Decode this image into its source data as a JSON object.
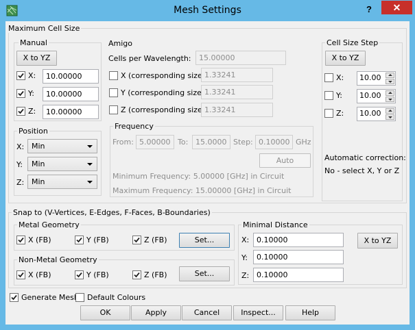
{
  "window": {
    "title": "Mesh Settings",
    "help_glyph": "?",
    "close_glyph": "✕"
  },
  "max_cell": {
    "title": "Maximum Cell Size",
    "manual": {
      "title": "Manual",
      "xtoyz_label": "X to YZ",
      "x": {
        "label": "X:",
        "value": "10.00000",
        "checked": true
      },
      "y": {
        "label": "Y:",
        "value": "10.00000",
        "checked": true
      },
      "z": {
        "label": "Z:",
        "value": "10.00000",
        "checked": true
      }
    },
    "position": {
      "title": "Position",
      "x": {
        "label": "X:",
        "value": "Min"
      },
      "y": {
        "label": "Y:",
        "value": "Min"
      },
      "z": {
        "label": "Z:",
        "value": "Min"
      }
    },
    "amigo": {
      "title": "Amigo",
      "cells_label": "Cells per Wavelength:",
      "cells_value": "15.00000",
      "x": {
        "label": "X (corresponding size)",
        "value": "1.33241"
      },
      "y": {
        "label": "Y (corresponding size)",
        "value": "1.33241"
      },
      "z": {
        "label": "Z (corresponding size)",
        "value": "1.33241"
      },
      "frequency": {
        "title": "Frequency",
        "from_label": "From:",
        "from_value": "5.00000",
        "to_label": "To:",
        "to_value": "15.00000",
        "step_label": "Step:",
        "step_value": "0.10000",
        "unit": "GHz",
        "auto_label": "Auto",
        "min_text": "Minimum Frequency: 5.00000 [GHz] in Circuit",
        "max_text": "Maximum Frequency: 15.00000 [GHz] in Circuit"
      }
    },
    "step": {
      "title": "Cell Size Step",
      "xtoyz_label": "X to YZ",
      "x": {
        "label": "X:",
        "value": "10.00"
      },
      "y": {
        "label": "Y:",
        "value": "10.00"
      },
      "z": {
        "label": "Z:",
        "value": "10.00"
      },
      "auto_title": "Automatic correction:",
      "auto_text": "No - select X, Y or Z"
    }
  },
  "snap": {
    "title": "Snap to (V-Vertices, E-Edges, F-Faces, B-Boundaries)",
    "metal": {
      "title": "Metal Geometry",
      "x": "X (FB)",
      "y": "Y (FB)",
      "z": "Z (FB)",
      "set_label": "Set..."
    },
    "nonmetal": {
      "title": "Non-Metal Geometry",
      "x": "X (FB)",
      "y": "Y (FB)",
      "z": "Z (FB)",
      "set_label": "Set..."
    },
    "minimal": {
      "title": "Minimal Distance",
      "x_label": "X:",
      "x_value": "0.10000",
      "y_label": "Y:",
      "y_value": "0.10000",
      "z_label": "Z:",
      "z_value": "0.10000",
      "xtoyz_label": "X to YZ"
    }
  },
  "bottom": {
    "generate_mesh": "Generate Mesh",
    "generate_mesh_checked": true,
    "default_colours": "Default Colours",
    "default_colours_checked": false,
    "ok": "OK",
    "apply": "Apply",
    "cancel": "Cancel",
    "inspect": "Inspect...",
    "help": "Help"
  }
}
